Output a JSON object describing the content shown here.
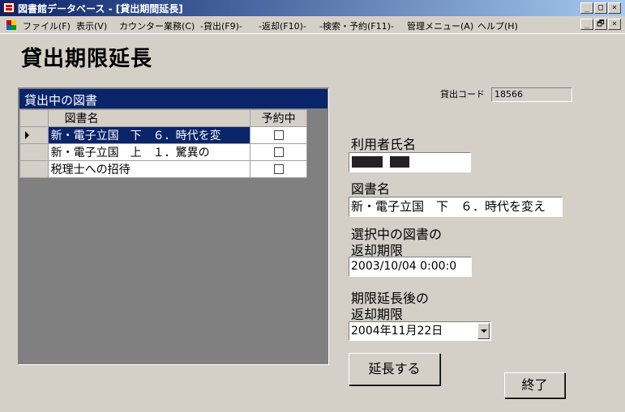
{
  "window": {
    "title": "図書館データベース - [貸出期間延長]",
    "controls": [
      "_",
      "□",
      "×"
    ],
    "doc_controls": [
      "_",
      "🗗",
      "×"
    ]
  },
  "menu": {
    "items": [
      "ファイル(F)",
      "表示(V)",
      "カウンター業務(C)",
      "-貸出(F9)-",
      "-返却(F10)-",
      "-検索・予約(F11)-",
      "管理メニュー(A)",
      "ヘルプ(H)"
    ]
  },
  "page": {
    "title": "貸出期限延長"
  },
  "loans": {
    "header": "貸出中の図書",
    "columns": [
      "図書名",
      "予約中"
    ],
    "rows": [
      {
        "title": "新・電子立国　下　６．時代を変",
        "reserved": false
      },
      {
        "title": "新・電子立国　上　１．驚異の",
        "reserved": false
      },
      {
        "title": "税理士への招待",
        "reserved": false
      }
    ]
  },
  "form": {
    "code_label": "貸出コード",
    "code_value": "18566",
    "user_label": "利用者氏名",
    "book_label": "図書名",
    "book_value": "新・電子立国　下　６．時代を変え",
    "due_label_1": "選択中の図書の",
    "due_label_2": "返却期限",
    "due_value": "2003/10/04 0:00:0",
    "new_due_label_1": "期限延長後の",
    "new_due_label_2": "返却期限",
    "new_due_value": "2004年11月22日",
    "extend_button": "延長する",
    "close_button": "終了"
  },
  "colors": {
    "title_bar": "#0a246a",
    "selection": "#0a246a",
    "face": "#d4d0c8",
    "panel": "#808080"
  }
}
